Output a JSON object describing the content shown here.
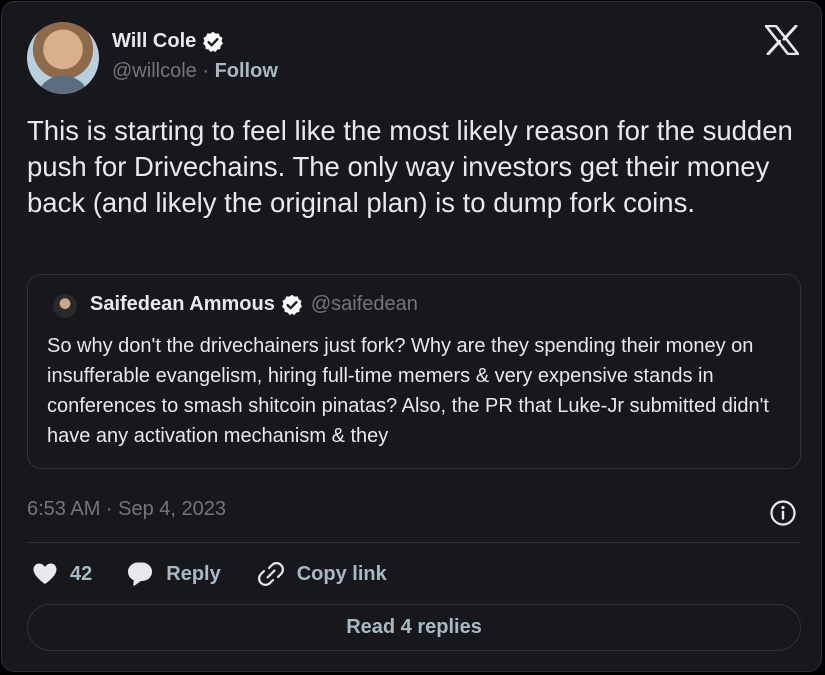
{
  "author": {
    "name": "Will Cole",
    "handle": "@willcole",
    "separator": "·",
    "follow_label": "Follow"
  },
  "tweet": {
    "text": "This is starting to feel like the most likely reason for the sudden push for Drivechains. The only way investors get their money back (and likely the original plan) is to dump fork coins."
  },
  "quoted": {
    "name": "Saifedean Ammous",
    "handle": "@saifedean",
    "text": "So why don't the drivechainers just fork? Why are they  spending their money on insufferable evangelism, hiring full-time memers & very expensive stands in conferences to smash shitcoin pinatas? Also, the PR that Luke-Jr submitted didn't have any activation mechanism & they"
  },
  "meta": {
    "timestamp": "6:53 AM · Sep 4, 2023"
  },
  "actions": {
    "like_count": "42",
    "reply_label": "Reply",
    "copy_link_label": "Copy link"
  },
  "read_replies_label": "Read 4 replies",
  "icons": {
    "logo": "x-logo-icon",
    "verified": "verified-badge-icon",
    "info": "info-icon",
    "like": "heart-icon",
    "reply": "speech-bubble-icon",
    "copy": "link-icon"
  },
  "colors": {
    "background": "#000000",
    "card": "#16181c",
    "border": "#2f3336",
    "text": "#e7e9ea",
    "muted": "#71767b",
    "action": "#aab8c2"
  }
}
